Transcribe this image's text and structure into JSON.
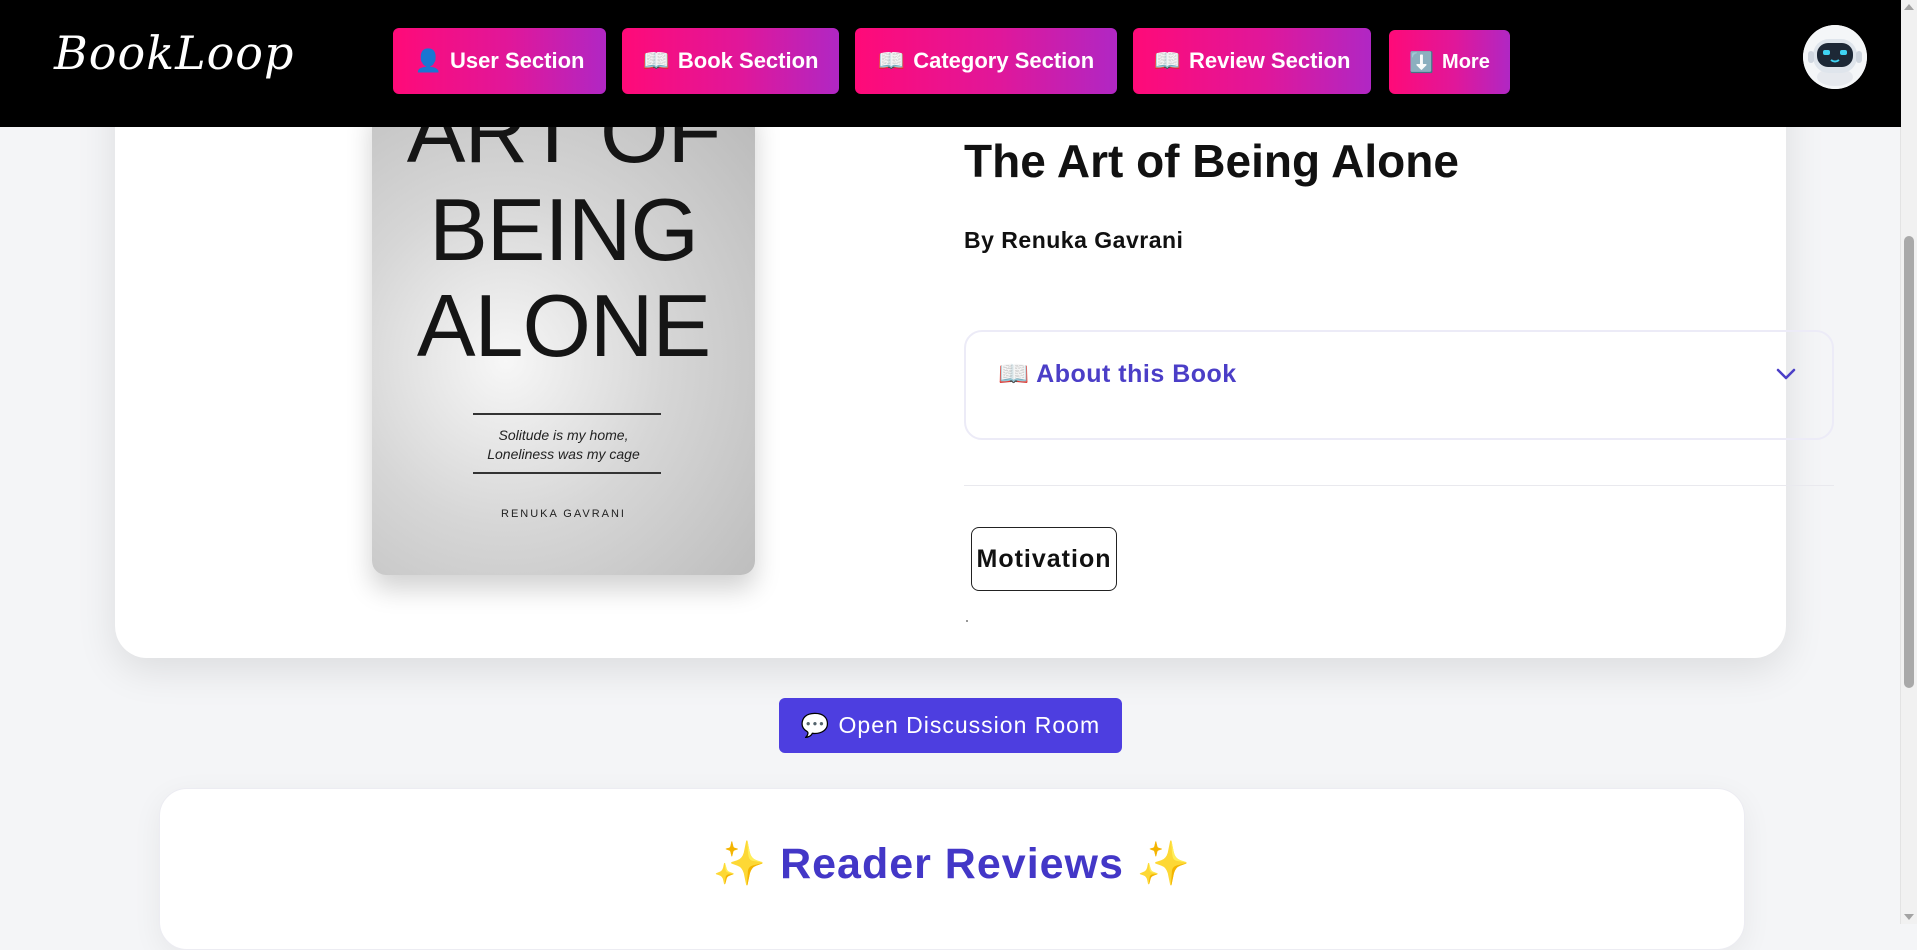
{
  "navbar": {
    "logo": "BookLoop",
    "buttons": [
      {
        "icon": "👤",
        "label": "User Section"
      },
      {
        "icon": "📖",
        "label": "Book Section"
      },
      {
        "icon": "📖",
        "label": "Category Section"
      },
      {
        "icon": "📖",
        "label": "Review Section"
      },
      {
        "icon": "⬇️",
        "label": "More"
      }
    ],
    "avatar": "robot-avatar"
  },
  "book": {
    "title": "The Art of Being Alone",
    "author_line": "By Renuka Gavrani",
    "cover": {
      "lines": [
        "ART OF",
        "BEING",
        "ALONE"
      ],
      "tagline_1": "Solitude is my home,",
      "tagline_2": "Loneliness was my cage",
      "author": "RENUKA GAVRANI"
    },
    "about": {
      "icon": "📖",
      "label": "About this Book"
    },
    "tags": [
      "Motivation"
    ]
  },
  "discussion": {
    "icon": "💬",
    "label": "Open Discussion Room"
  },
  "reviews": {
    "title": "Reader Reviews",
    "sparkle": "✨"
  },
  "colors": {
    "nav_gradient_start": "#ff0a78",
    "nav_gradient_end": "#b027c4",
    "accent_indigo": "#4d3ee0",
    "heading_indigo": "#4337c7"
  }
}
